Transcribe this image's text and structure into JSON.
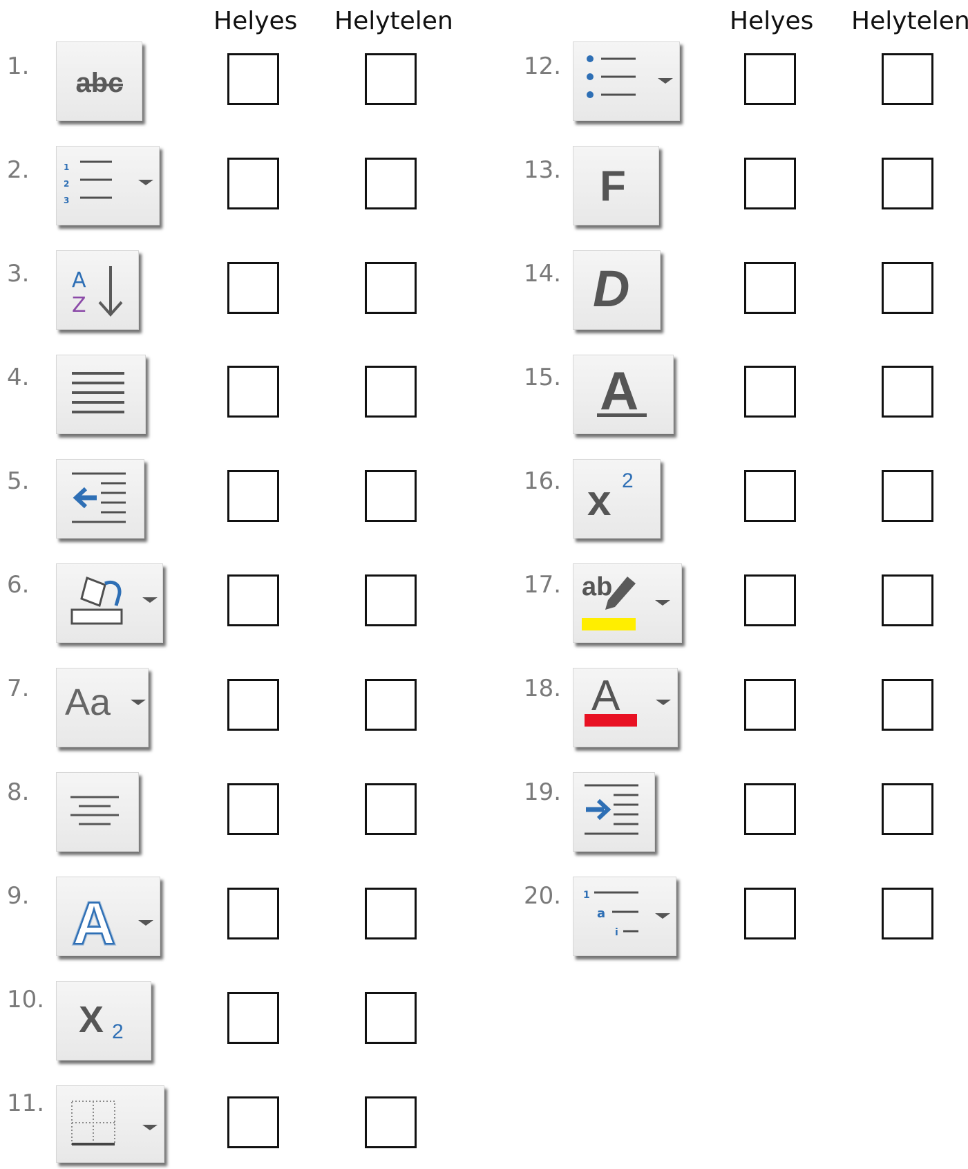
{
  "headers": {
    "left_correct": "Helyes",
    "left_incorrect": "Helytelen",
    "right_correct": "Helyes",
    "right_incorrect": "Helytelen"
  },
  "items": [
    {
      "number": "1.",
      "icon": "strikethrough-icon",
      "icon_text": "abc"
    },
    {
      "number": "2.",
      "icon": "numbered-list-icon"
    },
    {
      "number": "3.",
      "icon": "sort-az-icon"
    },
    {
      "number": "4.",
      "icon": "justify-icon"
    },
    {
      "number": "5.",
      "icon": "decrease-indent-icon"
    },
    {
      "number": "6.",
      "icon": "shading-bucket-icon"
    },
    {
      "number": "7.",
      "icon": "change-case-icon",
      "icon_text": "Aa"
    },
    {
      "number": "8.",
      "icon": "align-center-icon"
    },
    {
      "number": "9.",
      "icon": "text-effects-icon",
      "icon_text": "A"
    },
    {
      "number": "10.",
      "icon": "subscript-icon",
      "icon_text": "X",
      "icon_sub": "2"
    },
    {
      "number": "11.",
      "icon": "borders-icon"
    },
    {
      "number": "12.",
      "icon": "bullet-list-icon"
    },
    {
      "number": "13.",
      "icon": "bold-icon",
      "icon_text": "F"
    },
    {
      "number": "14.",
      "icon": "italic-icon",
      "icon_text": "D"
    },
    {
      "number": "15.",
      "icon": "underline-icon",
      "icon_text": "A"
    },
    {
      "number": "16.",
      "icon": "superscript-icon",
      "icon_text": "x",
      "icon_sup": "2"
    },
    {
      "number": "17.",
      "icon": "highlight-icon",
      "icon_text": "ab",
      "color": "#ffee00"
    },
    {
      "number": "18.",
      "icon": "font-color-icon",
      "icon_text": "A",
      "color": "#e81123"
    },
    {
      "number": "19.",
      "icon": "increase-indent-icon"
    },
    {
      "number": "20.",
      "icon": "multilevel-list-icon",
      "icon_text": "1 a i"
    }
  ],
  "colors": {
    "icon_blue": "#2e6fb5",
    "icon_gray": "#4f4f4f",
    "sort_purple": "#8b4aa8"
  }
}
